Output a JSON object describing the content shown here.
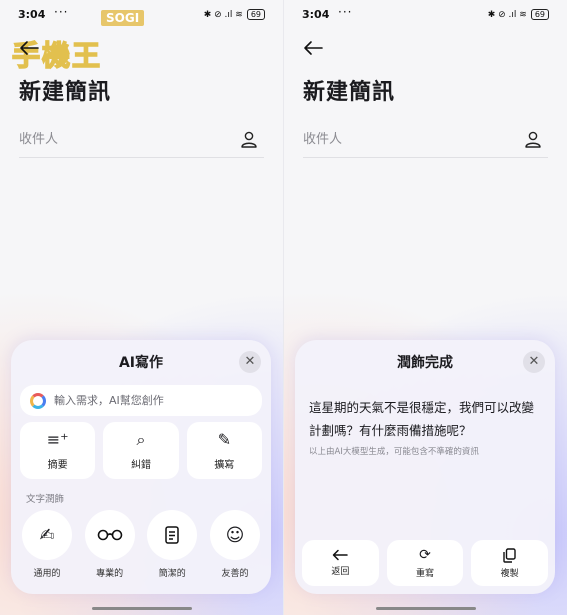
{
  "status_bar": {
    "time": "3:04",
    "dots": "···",
    "icons": "✱ ⊘ .ıl ≋",
    "battery": "69"
  },
  "watermark": {
    "brand": "SOGI",
    "text": "手機王"
  },
  "left": {
    "title": "新建簡訊",
    "recipient_placeholder": "收件人",
    "sheet": {
      "title": "AI寫作",
      "input_placeholder": "輸入需求，AI幫您創作",
      "tools": [
        {
          "label": "摘要",
          "icon": "summary-icon"
        },
        {
          "label": "糾錯",
          "icon": "search-correct-icon"
        },
        {
          "label": "擴寫",
          "icon": "edit-expand-icon"
        }
      ],
      "section_label": "文字潤飾",
      "tones": [
        {
          "label": "通用的",
          "icon": "pen-icon"
        },
        {
          "label": "專業的",
          "icon": "glasses-icon"
        },
        {
          "label": "簡潔的",
          "icon": "document-icon"
        },
        {
          "label": "友善的",
          "icon": "smile-icon"
        }
      ]
    }
  },
  "right": {
    "title": "新建簡訊",
    "recipient_placeholder": "收件人",
    "sheet": {
      "title": "潤飾完成",
      "result": "這星期的天氣不是很穩定，我們可以改變計劃嗎？有什麼雨備措施呢？",
      "disclaimer": "以上由AI大模型生成，可能包含不準確的資訊",
      "actions": [
        {
          "label": "返回",
          "icon": "arrow-left-icon"
        },
        {
          "label": "重寫",
          "icon": "refresh-icon"
        },
        {
          "label": "複製",
          "icon": "copy-icon"
        }
      ]
    }
  }
}
